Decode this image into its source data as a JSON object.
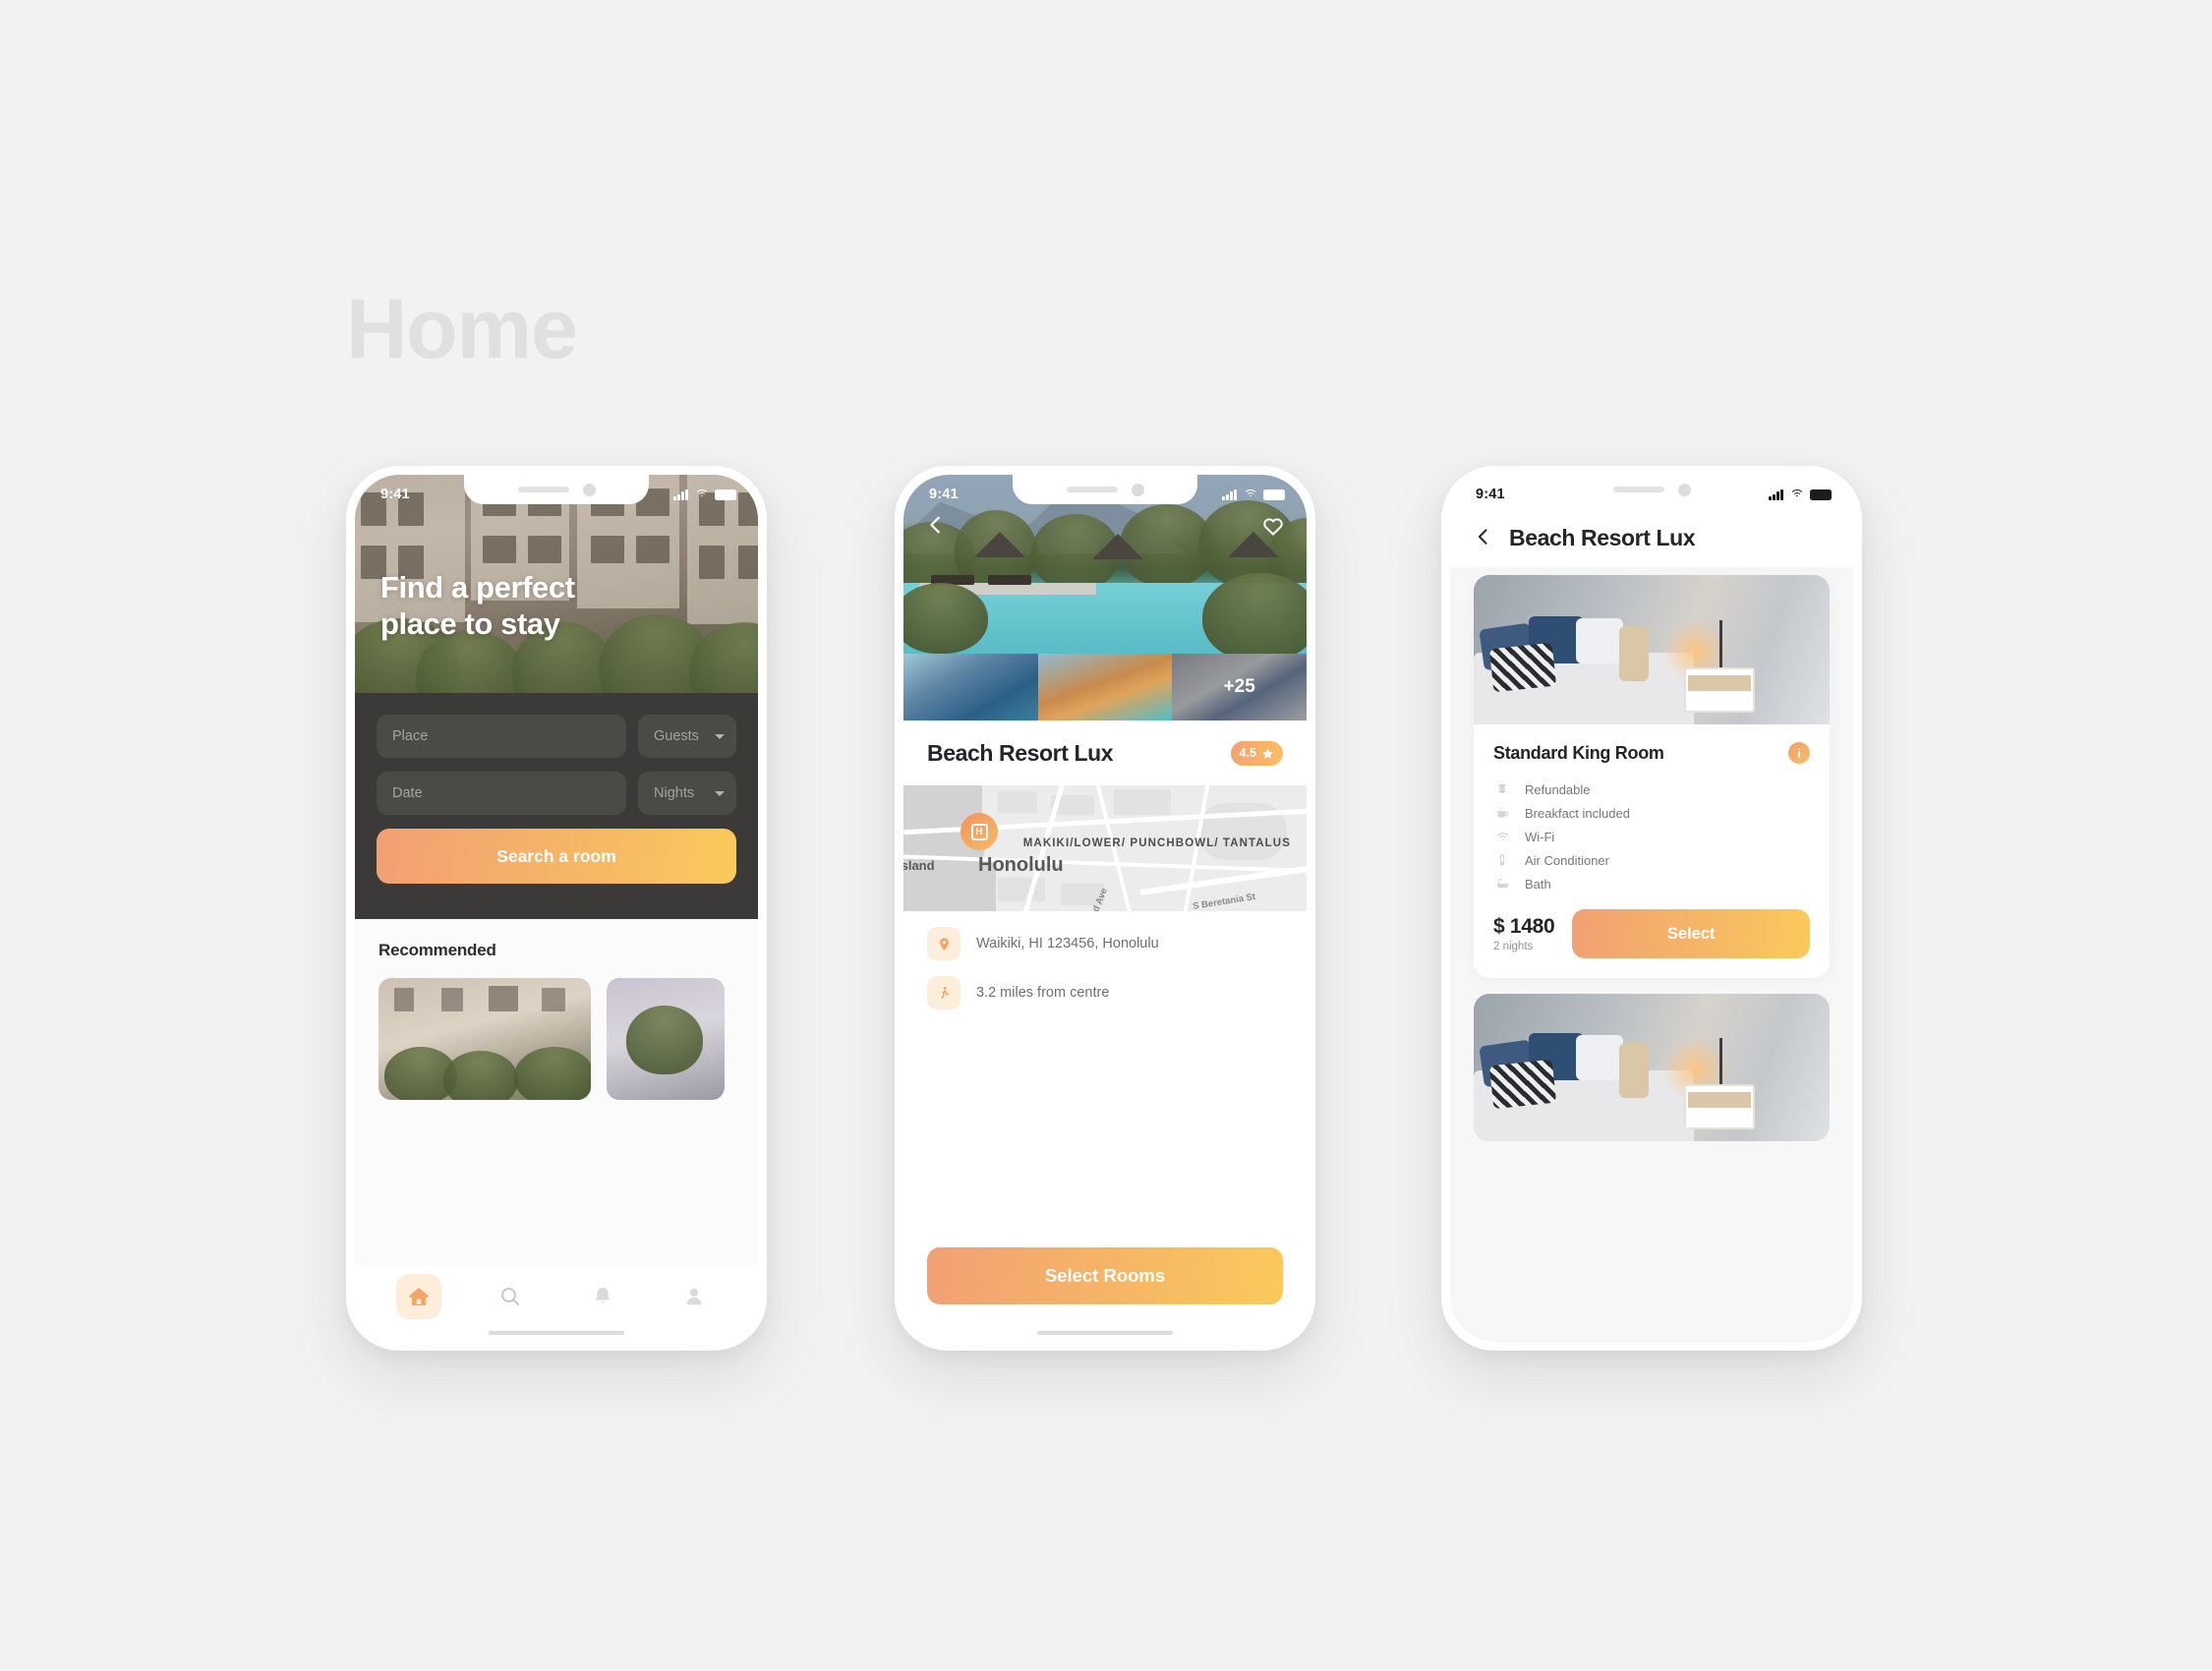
{
  "page": {
    "title": "Home"
  },
  "status_bar": {
    "time": "9:41",
    "signal_icon": "cellular-bars-icon",
    "wifi_icon": "wifi-icon",
    "battery_icon": "battery-icon"
  },
  "colors": {
    "accent_start": "#f2a073",
    "accent_end": "#fbc95c",
    "accent_soft_bg": "#fdeedc",
    "panel_dark": "#3b3a38",
    "field_dark": "#4b4a47"
  },
  "phone1": {
    "hero_heading": "Find a perfect place to stay",
    "form": {
      "place": {
        "placeholder": "Place",
        "value": ""
      },
      "guests": {
        "label": "Guests",
        "caret_icon": "chevron-down-icon"
      },
      "date": {
        "placeholder": "Date",
        "value": ""
      },
      "nights": {
        "label": "Nights",
        "caret_icon": "chevron-down-icon"
      },
      "submit_label": "Search a room"
    },
    "recommended": {
      "title": "Recommended"
    },
    "tabbar": [
      {
        "name": "home",
        "icon": "home-icon",
        "active": true
      },
      {
        "name": "search",
        "icon": "search-icon",
        "active": false
      },
      {
        "name": "notifications",
        "icon": "bell-icon",
        "active": false
      },
      {
        "name": "profile",
        "icon": "person-icon",
        "active": false
      }
    ]
  },
  "phone2": {
    "back_icon": "chevron-left-icon",
    "favorite_icon": "heart-icon",
    "gallery": {
      "more_count": "+25"
    },
    "hotel_name": "Beach Resort Lux",
    "rating": {
      "value": "4.5",
      "icon": "star-icon"
    },
    "map": {
      "pin_icon": "hotel-pin-icon",
      "pin_letter": "H",
      "city_label": "Honolulu",
      "island_label": "Island",
      "area_label": "MAKIKI/LOWER/ PUNCHBOWL/ TANTALUS",
      "street_label_1": "S Beretania St",
      "street_label_2": "...ard Ave"
    },
    "details": [
      {
        "icon": "location-pin-icon",
        "text": "Waikiki, HI 123456, Honolulu"
      },
      {
        "icon": "walking-person-icon",
        "text": "3.2 miles from centre"
      }
    ],
    "cta_label": "Select Rooms"
  },
  "phone3": {
    "back_icon": "chevron-left-icon",
    "header_title": "Beach Resort Lux",
    "room": {
      "name": "Standard King Room",
      "info_icon": "info-icon",
      "amenities": [
        {
          "icon": "coins-icon",
          "label": "Refundable"
        },
        {
          "icon": "coffee-cup-icon",
          "label": "Breakfact included"
        },
        {
          "icon": "wifi-icon",
          "label": "Wi-Fi"
        },
        {
          "icon": "thermometer-icon",
          "label": "Air Conditioner"
        },
        {
          "icon": "bathtub-icon",
          "label": "Bath"
        }
      ],
      "price": "$ 1480",
      "price_sub": "2 nights",
      "select_label": "Select"
    }
  }
}
